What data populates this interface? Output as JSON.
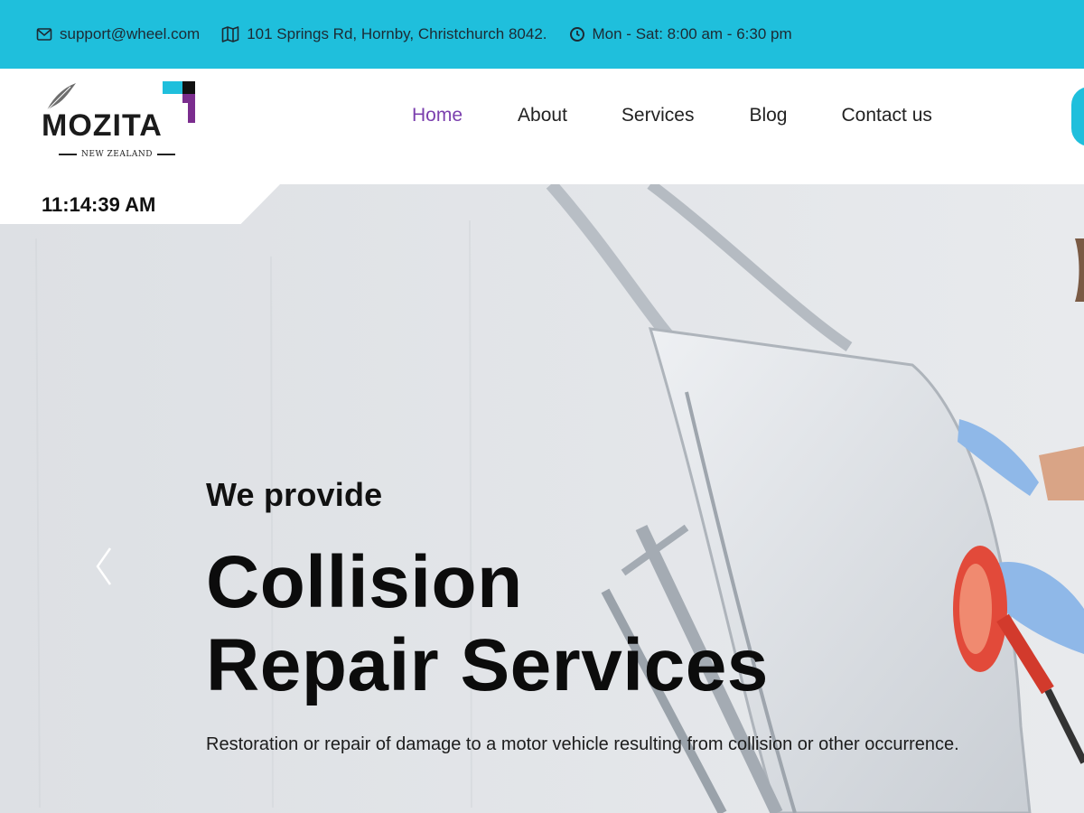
{
  "topbar": {
    "email": "support@wheel.com",
    "address": "101 Springs Rd, Hornby, Christchurch 8042.",
    "hours": "Mon - Sat: 8:00 am - 6:30 pm"
  },
  "logo": {
    "name": "MOZITA",
    "subtitle": "NEW ZEALAND"
  },
  "nav": {
    "items": [
      {
        "label": "Home",
        "active": true
      },
      {
        "label": "About",
        "active": false
      },
      {
        "label": "Services",
        "active": false
      },
      {
        "label": "Blog",
        "active": false
      },
      {
        "label": "Contact us",
        "active": false
      }
    ]
  },
  "clock": "11:14:39 AM",
  "hero": {
    "eyebrow": "We provide",
    "headline_line1": "Collision",
    "headline_line2": "Repair Services",
    "description": "Restoration or repair of damage to a motor vehicle resulting from collision or other occurrence."
  },
  "colors": {
    "accent": "#1fbfdc",
    "active_nav": "#7b3fae",
    "logo_purple": "#7b2d8e"
  }
}
